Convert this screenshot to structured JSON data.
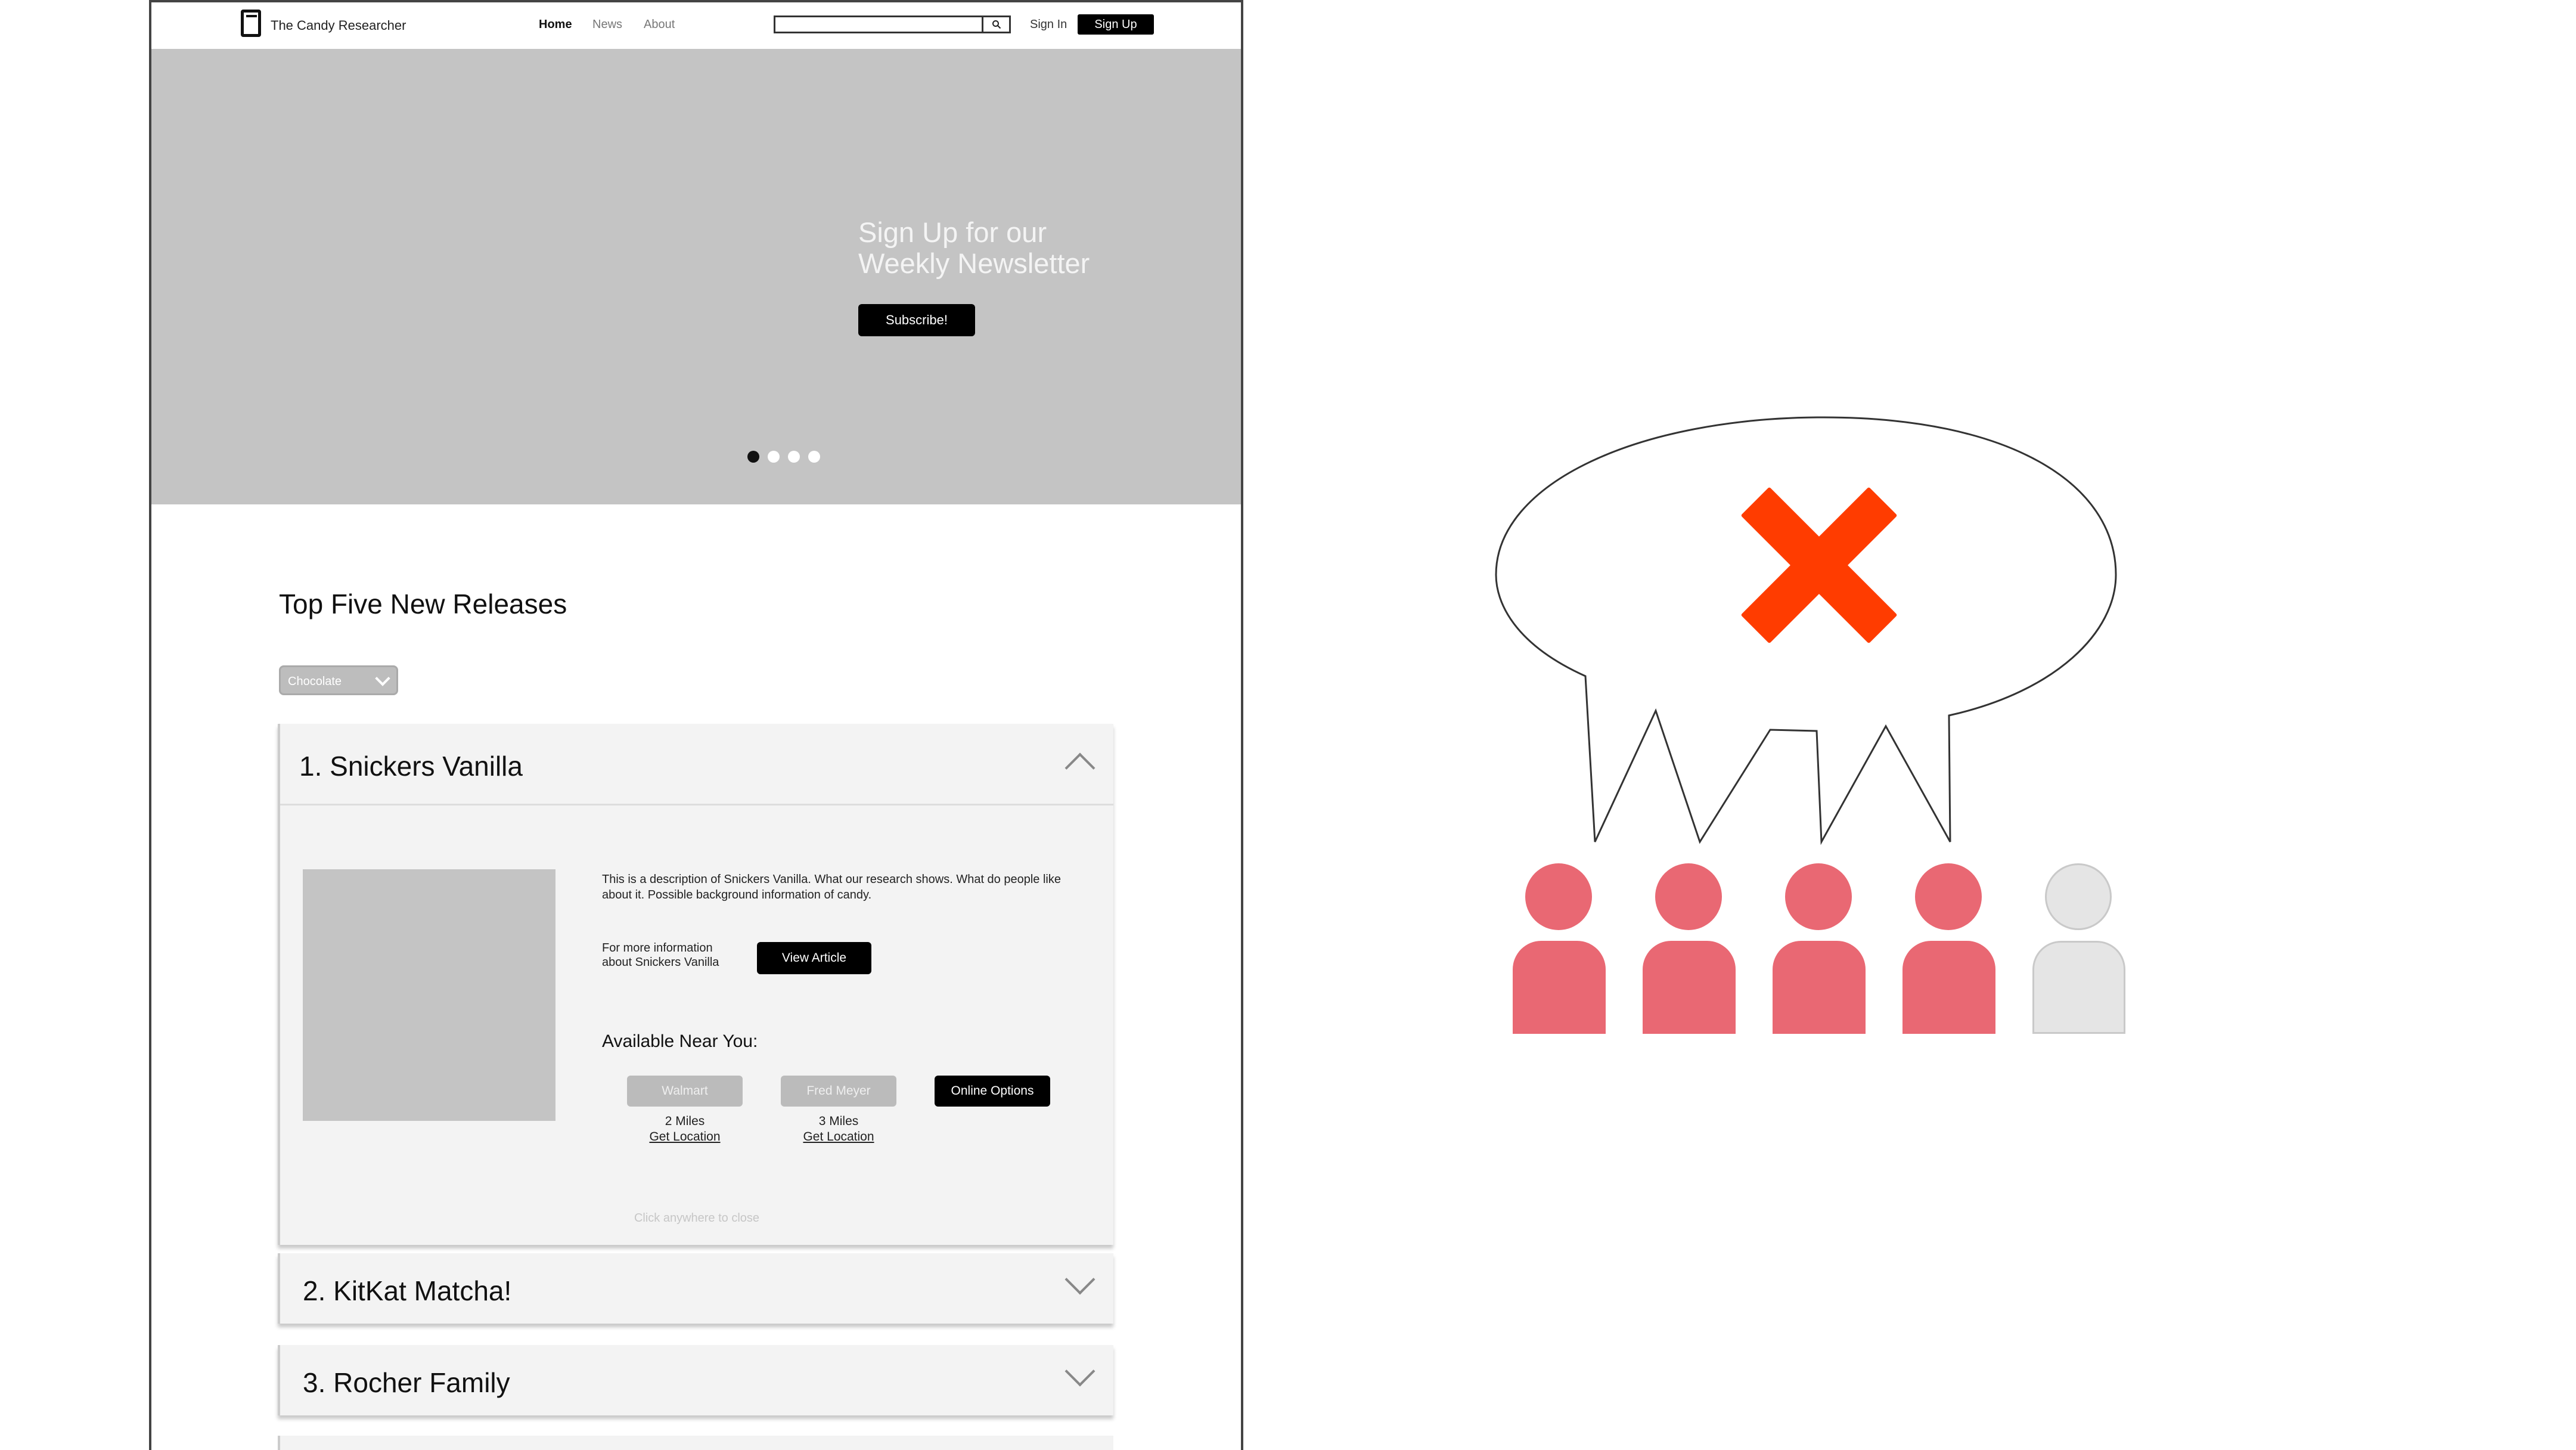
{
  "nav": {
    "brand": "The Candy Researcher",
    "links": [
      "Home",
      "News",
      "About"
    ],
    "search_icon": "magnifier-icon",
    "sign_in": "Sign In",
    "sign_up": "Sign Up"
  },
  "hero": {
    "title_line1": "Sign Up for our",
    "title_line2": "Weekly Newsletter",
    "button": "Subscribe!",
    "carousel_active": 1,
    "carousel_count": 4
  },
  "releases": {
    "title": "Top Five New Releases",
    "filter": "Chocolate",
    "items": [
      {
        "title": "1. Snickers Vanilla",
        "expanded": true,
        "description": "This is a description of Snickers Vanilla. What our research shows. What do people like about it. Possible background information of candy.",
        "more_info": "For more information about Snickers Vanilla",
        "view_button": "View Article",
        "available_title": "Available Near You:",
        "stores": [
          {
            "name": "Walmart",
            "distance": "2 Miles",
            "link": "Get Location"
          },
          {
            "name": "Fred Meyer",
            "distance": "3 Miles",
            "link": "Get Location"
          },
          {
            "name": "Online Options"
          }
        ],
        "close_hint": "Click anywhere to close"
      },
      {
        "title": "2. KitKat Matcha!",
        "expanded": false
      },
      {
        "title": "3. Rocher Family",
        "expanded": false
      }
    ]
  },
  "illustration": {
    "mark_icon": "x-mark-icon",
    "mark_color": "#ff3c00",
    "people_colors": [
      "#e96873",
      "#e96873",
      "#e96873",
      "#e96873",
      "#e5e5e5"
    ]
  }
}
